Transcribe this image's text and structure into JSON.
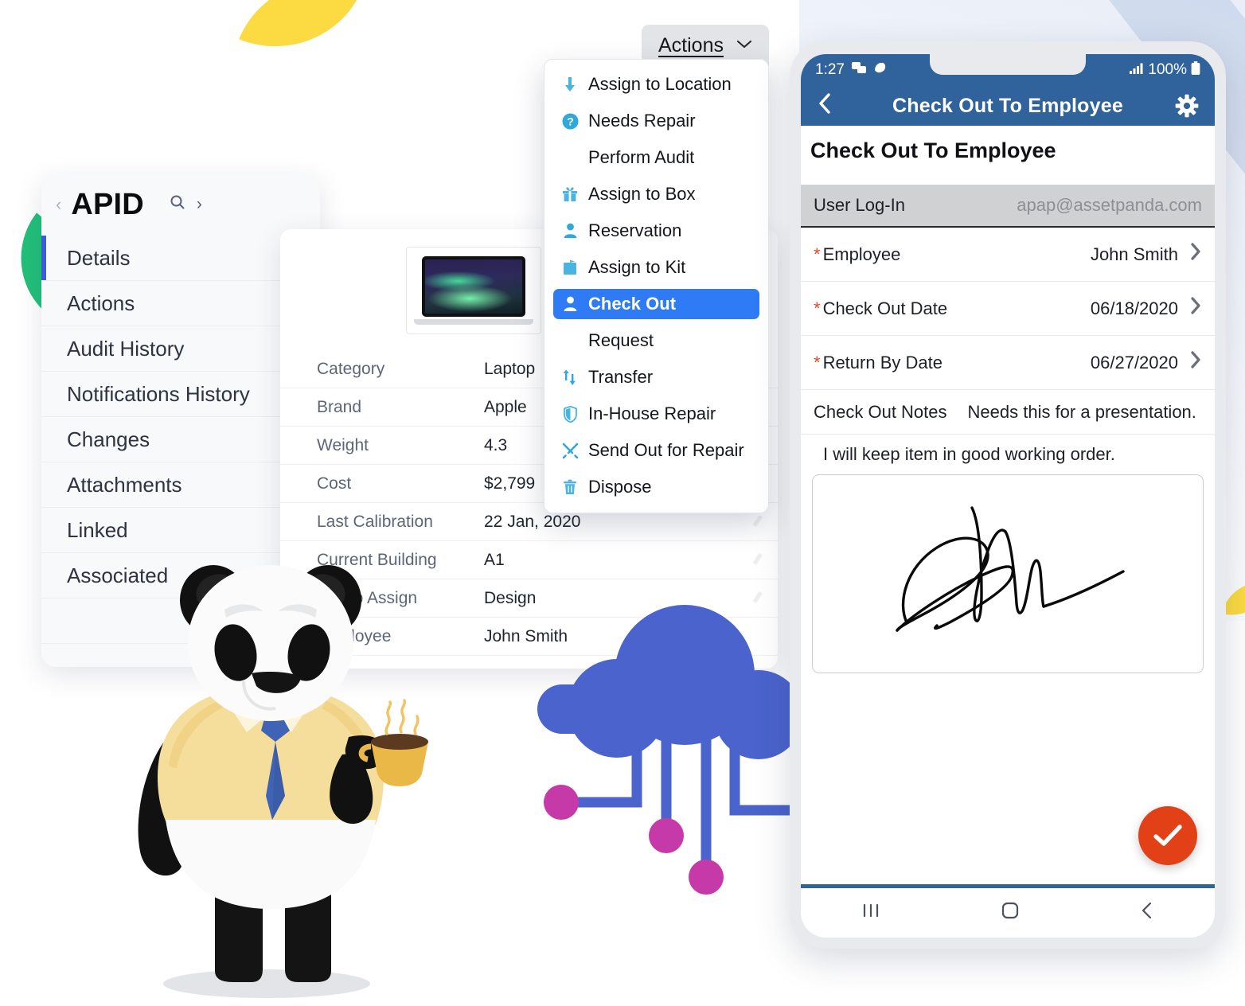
{
  "sidebar": {
    "back_icon": "chevron-left-icon",
    "title": "APID",
    "search_icon": "search-icon",
    "next_icon": "chevron-right-icon",
    "items": [
      {
        "label": "Details",
        "active": true
      },
      {
        "label": "Actions",
        "active": false
      },
      {
        "label": "Audit History",
        "active": false
      },
      {
        "label": "Notifications History",
        "active": false
      },
      {
        "label": "Changes",
        "active": false
      },
      {
        "label": "Attachments",
        "active": false
      },
      {
        "label": "Linked",
        "active": false
      },
      {
        "label": "Associated",
        "active": false
      }
    ]
  },
  "details": {
    "thumbnail_icon": "laptop-thumbnail",
    "rows": [
      {
        "label": "Category",
        "value": "Laptop",
        "editable": false
      },
      {
        "label": "Brand",
        "value": "Apple",
        "editable": false
      },
      {
        "label": "Weight",
        "value": "4.3",
        "editable": false
      },
      {
        "label": "Cost",
        "value": "$2,799",
        "editable": false
      },
      {
        "label": "Last Calibration",
        "value": "22 Jan, 2020",
        "editable": true
      },
      {
        "label": "Current Building",
        "value": "A1",
        "editable": true
      },
      {
        "label": "Group Assign",
        "value": "Design",
        "editable": true
      },
      {
        "label": "Employee",
        "value": "John Smith",
        "editable": false
      }
    ]
  },
  "actions_button": {
    "label": "Actions",
    "chevron_icon": "chevron-down-icon",
    "chevron_glyph": "ⱟ"
  },
  "actions_menu": {
    "items": [
      {
        "label": "Assign to Location",
        "icon": "down-arrow-icon",
        "glyph": "⬇",
        "selected": false
      },
      {
        "label": "Needs Repair",
        "icon": "question-circle-icon",
        "glyph": "❓",
        "selected": false
      },
      {
        "label": "Perform Audit",
        "icon": "none",
        "glyph": "",
        "selected": false
      },
      {
        "label": "Assign to Box",
        "icon": "gift-box-icon",
        "glyph": "🎁",
        "selected": false
      },
      {
        "label": "Reservation",
        "icon": "person-icon",
        "glyph": "👤",
        "selected": false
      },
      {
        "label": "Assign to Kit",
        "icon": "kit-icon",
        "glyph": "🗃",
        "selected": false
      },
      {
        "label": "Check Out",
        "icon": "person-icon",
        "glyph": "👤",
        "selected": true
      },
      {
        "label": "Request",
        "icon": "none",
        "glyph": "",
        "selected": false
      },
      {
        "label": "Transfer",
        "icon": "transfer-arrows-icon",
        "glyph": "⇅",
        "selected": false
      },
      {
        "label": "In-House Repair",
        "icon": "shield-icon",
        "glyph": "🛡",
        "selected": false
      },
      {
        "label": "Send Out for Repair",
        "icon": "tools-icon",
        "glyph": "⚒",
        "selected": false
      },
      {
        "label": "Dispose",
        "icon": "trash-icon",
        "glyph": "🗑",
        "selected": false
      }
    ]
  },
  "phone": {
    "status_bar": {
      "time": "1:27",
      "app_icon_1": "messaging-icon",
      "app_icon_2": "app-icon",
      "signal_icon": "signal-bars-icon",
      "battery_percent": "100%",
      "battery_icon": "battery-icon"
    },
    "app_bar": {
      "back_icon": "chevron-left-icon",
      "title": "Check Out To Employee",
      "settings_icon": "gear-icon"
    },
    "page_title": "Check Out To Employee",
    "user_login": {
      "label": "User Log-In",
      "value": "apap@assetpanda.com"
    },
    "fields": [
      {
        "required": true,
        "label": "Employee",
        "value": "John Smith",
        "arrow": "chevron-right-icon"
      },
      {
        "required": true,
        "label": "Check Out Date",
        "value": "06/18/2020",
        "arrow": "chevron-right-icon"
      },
      {
        "required": true,
        "label": "Return By Date",
        "value": "06/27/2020",
        "arrow": "chevron-right-icon"
      }
    ],
    "notes": {
      "label": "Check Out Notes",
      "value": "Needs this for a presentation."
    },
    "agreement": "I will keep item in good working order.",
    "signature_box": "signature-pad",
    "confirm_button": {
      "icon": "checkmark-icon",
      "glyph": "✓"
    },
    "nav_bar": {
      "recents_icon": "recents-icon",
      "home_icon": "home-icon",
      "back_icon": "back-icon"
    }
  },
  "decor": {
    "mascot": "panda-mascot",
    "cloud": "cloud-network-illustration",
    "leaf_yellow": "leaf-shape",
    "leaf_green": "leaf-shape"
  },
  "colors": {
    "brand_blue": "#30629c",
    "menu_selected": "#2f7bf6",
    "menu_icon": "#4ab4e0",
    "required_red": "#e8452a",
    "fab_orange": "#e24016",
    "accent_green": "#22c07a",
    "accent_yellow": "#fbdb41",
    "cloud_blue": "#4a63cd",
    "node_magenta": "#c53aa8",
    "sidebar_active": "#3b5ddb"
  }
}
